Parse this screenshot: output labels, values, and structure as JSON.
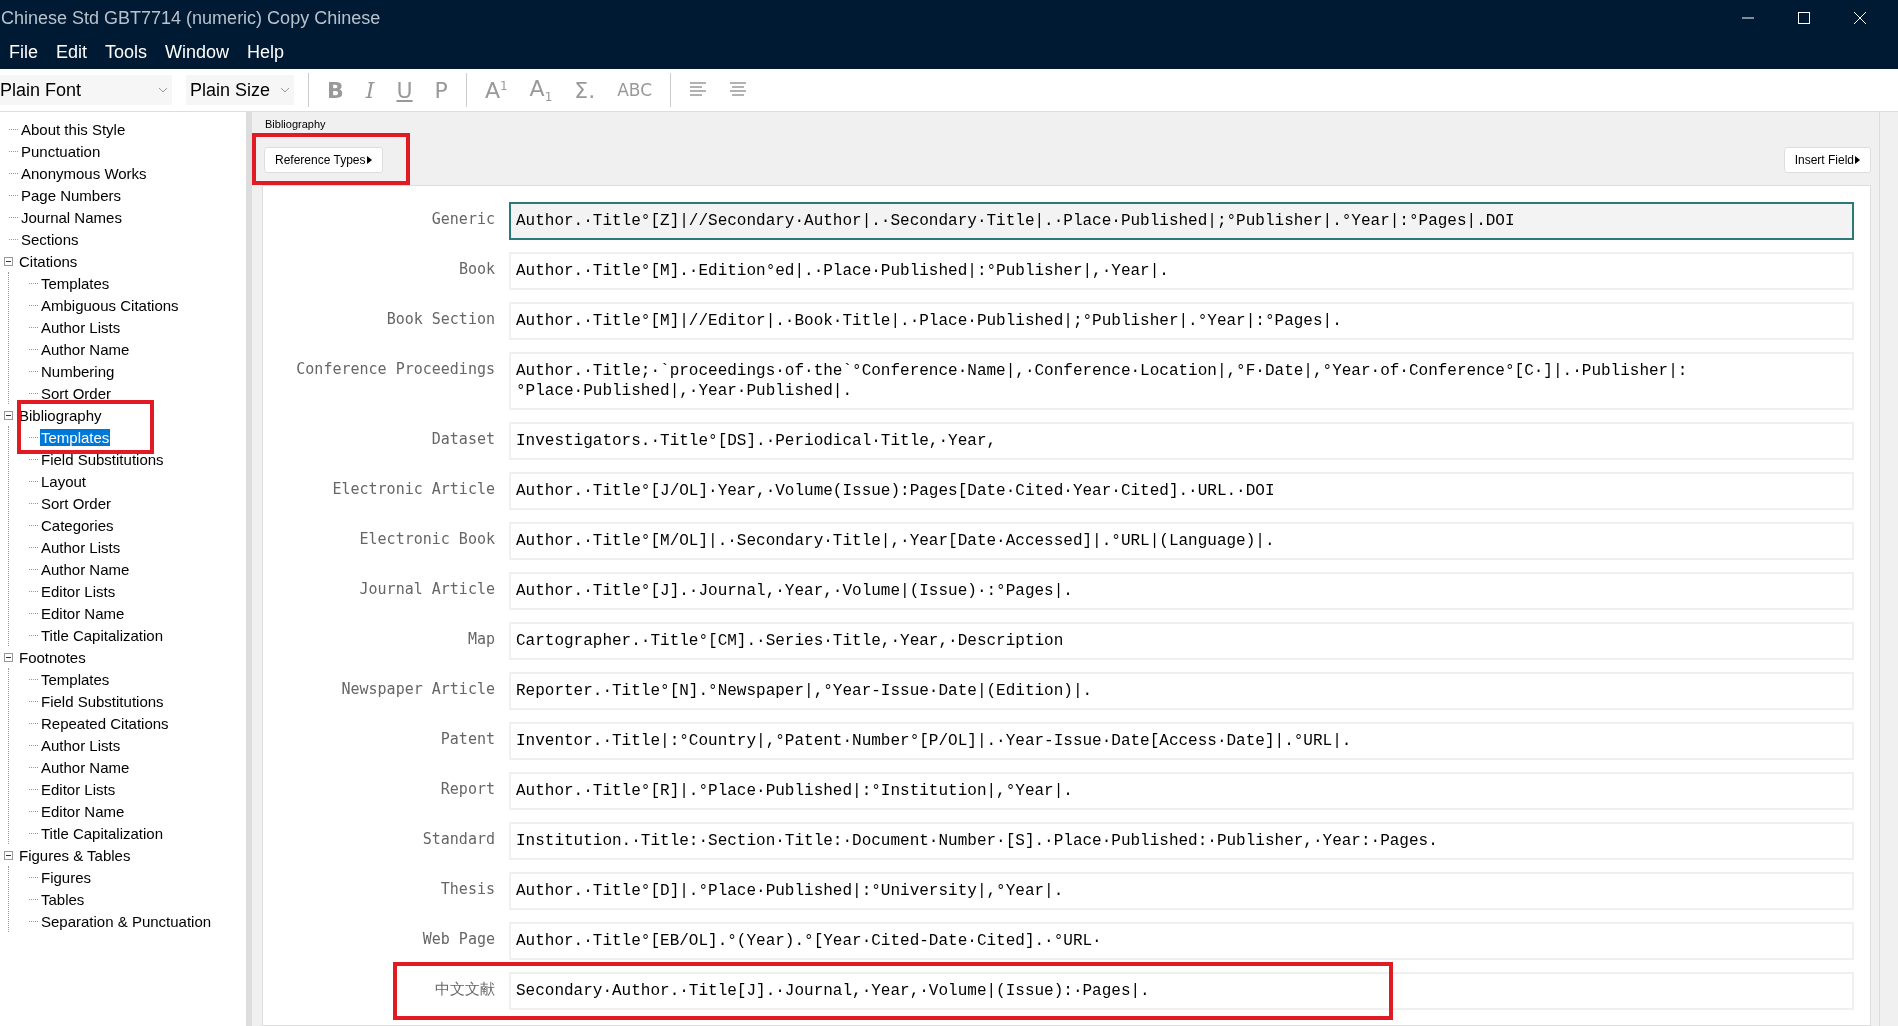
{
  "window": {
    "title": "Chinese Std GBT7714 (numeric) Copy Chinese"
  },
  "menu": [
    "File",
    "Edit",
    "Tools",
    "Window",
    "Help"
  ],
  "toolbar": {
    "font": "Plain Font",
    "size": "Plain Size",
    "buttons": [
      {
        "label": "B",
        "kind": "bold"
      },
      {
        "label": "I",
        "kind": "italic"
      },
      {
        "label": "U",
        "kind": "underline"
      },
      {
        "label": "P",
        "kind": "plain"
      },
      {
        "label": "A$^{1}$",
        "kind": "script"
      },
      {
        "label": "A$_{1}$",
        "kind": "script"
      },
      {
        "label": "Σ.",
        "kind": "script"
      },
      {
        "label": "ABC",
        "kind": "smallcaps"
      },
      {
        "kind": "align-left"
      },
      {
        "kind": "align-center"
      }
    ]
  },
  "sidebar": {
    "items": [
      {
        "label": "About this Style",
        "selected": false
      },
      {
        "label": "Punctuation",
        "selected": false
      },
      {
        "label": "Anonymous Works",
        "selected": false
      },
      {
        "label": "Page Numbers",
        "selected": false
      },
      {
        "label": "Journal Names",
        "selected": false
      },
      {
        "label": "Sections",
        "selected": false
      },
      {
        "label": "Citations",
        "selected": false,
        "expanded": true,
        "children": [
          {
            "label": "Templates",
            "selected": false
          },
          {
            "label": "Ambiguous Citations",
            "selected": false
          },
          {
            "label": "Author Lists",
            "selected": false
          },
          {
            "label": "Author Name",
            "selected": false
          },
          {
            "label": "Numbering",
            "selected": false
          },
          {
            "label": "Sort Order",
            "selected": false
          }
        ]
      },
      {
        "label": "Bibliography",
        "selected": false,
        "expanded": true,
        "annotated": true,
        "children": [
          {
            "label": "Templates",
            "selected": true
          },
          {
            "label": "Field Substitutions",
            "selected": false
          },
          {
            "label": "Layout",
            "selected": false
          },
          {
            "label": "Sort Order",
            "selected": false
          },
          {
            "label": "Categories",
            "selected": false
          },
          {
            "label": "Author Lists",
            "selected": false
          },
          {
            "label": "Author Name",
            "selected": false
          },
          {
            "label": "Editor Lists",
            "selected": false
          },
          {
            "label": "Editor Name",
            "selected": false
          },
          {
            "label": "Title Capitalization",
            "selected": false
          }
        ]
      },
      {
        "label": "Footnotes",
        "selected": false,
        "expanded": true,
        "children": [
          {
            "label": "Templates",
            "selected": false
          },
          {
            "label": "Field Substitutions",
            "selected": false
          },
          {
            "label": "Repeated Citations",
            "selected": false
          },
          {
            "label": "Author Lists",
            "selected": false
          },
          {
            "label": "Author Name",
            "selected": false
          },
          {
            "label": "Editor Lists",
            "selected": false
          },
          {
            "label": "Editor Name",
            "selected": false
          },
          {
            "label": "Title Capitalization",
            "selected": false
          }
        ]
      },
      {
        "label": "Figures & Tables",
        "selected": false,
        "expanded": true,
        "children": [
          {
            "label": "Figures",
            "selected": false
          },
          {
            "label": "Tables",
            "selected": false
          },
          {
            "label": "Separation & Punctuation",
            "selected": false
          }
        ]
      }
    ]
  },
  "panel": {
    "title": "Bibliography",
    "reference_types": {
      "label": "Reference Types",
      "annotated": true
    },
    "insert_field": "Insert Field",
    "templates": [
      {
        "type": "Generic",
        "template": "Author.·Title°[Z]|//Secondary·Author|.·Secondary·Title|.·Place·Published|;°Publisher|.°Year|:°Pages|.DOI",
        "selected": true
      },
      {
        "type": "Book",
        "template": "Author.·Title°[M].·Edition°ed|.·Place·Published|:°Publisher|,·Year|.",
        "selected": false
      },
      {
        "type": "Book Section",
        "template": "Author.·Title°[M]|//Editor|.·Book·Title|.·Place·Published|;°Publisher|.°Year|:°Pages|.",
        "selected": false
      },
      {
        "type": "Conference Proceedings",
        "template": "Author.·Title;·`proceedings·of·the`°Conference·Name|,·Conference·Location|,°F·Date|,°Year·of·Conference°[C·]|.·Publisher|:°Place·Published|,·Year·Published|.",
        "selected": false
      },
      {
        "type": "Dataset",
        "template": "Investigators.·Title°[DS].·Periodical·Title,·Year,",
        "selected": false
      },
      {
        "type": "Electronic Article",
        "template": "Author.·Title°[J/OL]·Year,·Volume(Issue):Pages[Date·Cited·Year·Cited].·URL.·DOI",
        "selected": false
      },
      {
        "type": "Electronic Book",
        "template": "Author.·Title°[M/OL]|.·Secondary·Title|,·Year[Date·Accessed]|.°URL|(Language)|.",
        "selected": false
      },
      {
        "type": "Journal Article",
        "template": "Author.·Title°[J].·Journal,·Year,·Volume|(Issue)·:°Pages|.",
        "selected": false
      },
      {
        "type": "Map",
        "template": "Cartographer.·Title°[CM].·Series·Title,·Year,·Description",
        "selected": false
      },
      {
        "type": "Newspaper Article",
        "template": "Reporter.·Title°[N].°Newspaper|,°Year-Issue·Date|(Edition)|.",
        "selected": false
      },
      {
        "type": "Patent",
        "template": "Inventor.·Title|:°Country|,°Patent·Number°[P/OL]|.·Year-Issue·Date[Access·Date]|.°URL|.",
        "selected": false
      },
      {
        "type": "Report",
        "template": "Author.·Title°[R]|.°Place·Published|:°Institution|,°Year|.",
        "selected": false
      },
      {
        "type": "Standard",
        "template": "Institution.·Title:·Section·Title:·Document·Number·[S].·Place·Published:·Publisher,·Year:·Pages.",
        "selected": false
      },
      {
        "type": "Thesis",
        "template": "Author.·Title°[D]|.°Place·Published|:°University|,°Year|.",
        "selected": false
      },
      {
        "type": "Web Page",
        "template": "Author.·Title°[EB/OL].°(Year).°[Year·Cited-Date·Cited].·°URL·",
        "selected": false
      },
      {
        "type": "中文文献",
        "template": "Secondary·Author.·Title[J].·Journal,·Year,·Volume|(Issue):·Pages|.",
        "selected": false,
        "annotated": true
      }
    ]
  }
}
